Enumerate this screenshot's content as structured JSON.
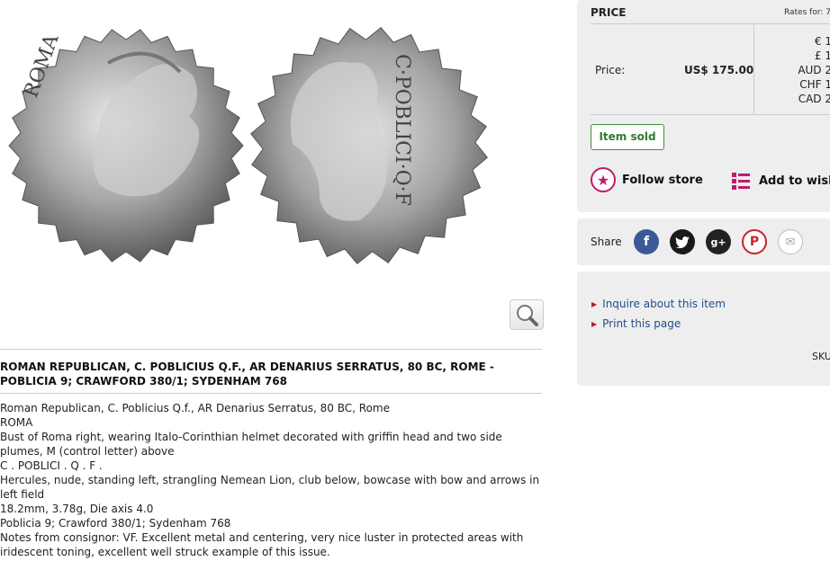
{
  "item": {
    "title": "ROMAN REPUBLICAN, C. POBLICIUS Q.F., AR DENARIUS SERRATUS, 80 BC, ROME - POBLICIA 9; CRAWFORD 380/1; SYDENHAM 768",
    "description_lines": [
      "Roman Republican, C. Poblicius Q.f., AR Denarius Serratus, 80 BC, Rome",
      "ROMA",
      "Bust of Roma right, wearing Italo-Corinthian helmet decorated with griffin head and two side plumes, M (control letter) above",
      "C . POBLICI . Q . F .",
      "Hercules, nude, standing left, strangling Nemean Lion, club below, bowcase with bow and arrows in left field",
      "18.2mm, 3.78g, Die axis 4.0",
      "Poblicia 9; Crawford 380/1; Sydenham 768"
    ],
    "notes": "Notes from consignor: VF. Excellent metal and centering, very nice luster in protected areas with iridescent toning, excellent well struck example of this issue."
  },
  "coin": {
    "obverse_legend": "ROMA",
    "reverse_legend": "C·POBLICI·Q·F",
    "zoom_icon": "magnifier-icon"
  },
  "price_panel": {
    "heading": "PRICE",
    "rates_label": "Rates for: 7",
    "price_label": "Price:",
    "price_value": "US$ 175.00",
    "rates": [
      "€ 1",
      "£ 1",
      "AUD 2",
      "CHF 1",
      "CAD 2"
    ],
    "sold_badge": "Item sold",
    "follow_label": "Follow store",
    "follow_icon": "star-icon",
    "wish_label": "Add to wish",
    "wish_icon": "list-icon",
    "accent_color": "#c01a6b"
  },
  "share": {
    "label": "Share",
    "buttons": [
      "facebook-icon",
      "twitter-icon",
      "google-plus-icon",
      "pinterest-icon",
      "email-icon"
    ]
  },
  "links": {
    "inquire": "Inquire about this item",
    "print": "Print this page",
    "sku": "SKU"
  }
}
